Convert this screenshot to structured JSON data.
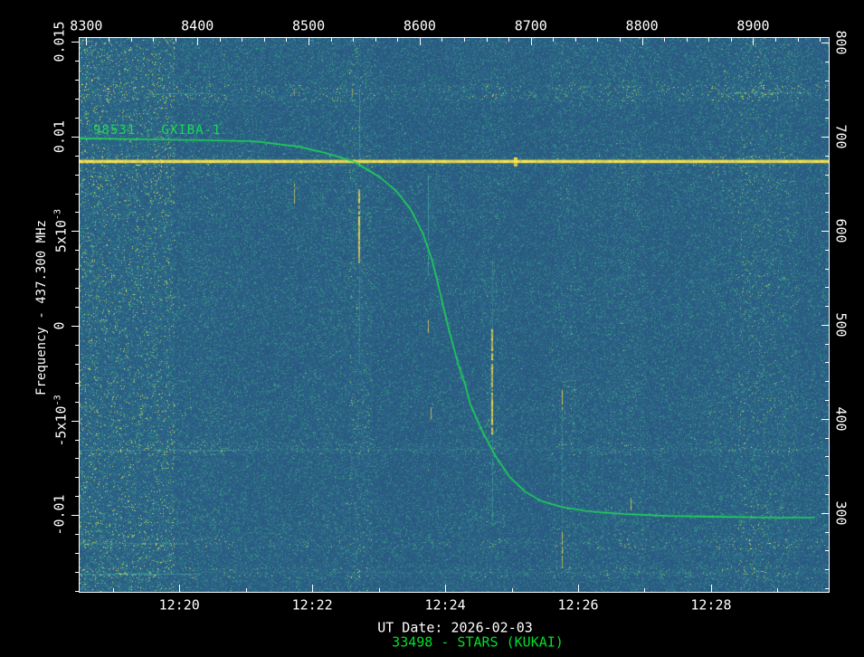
{
  "colors": {
    "background": "#000000",
    "axis_text": "#ffffff",
    "overlay_green": "#15dc52",
    "signal_yellow": "#ffe84d",
    "noise_teal": "#50d7af"
  },
  "footer": {
    "ut_date": "UT Date: 2026-02-03",
    "satellite": "33498 - STARS (KUKAI)"
  },
  "chart_data": {
    "type": "heatmap",
    "subtype": "radio-waterfall-spectrogram",
    "description": "Ground-station waterfall spectrogram (UT time vs frequency offset, power as color) with constant carrier line and predicted satellite Doppler S-curve",
    "grid": "off",
    "time_axis": {
      "side": "bottom",
      "tick_minutes": [
        20,
        22,
        24,
        26,
        28
      ],
      "tick_labels": [
        "12:20",
        "12:22",
        "12:24",
        "12:26",
        "12:28"
      ],
      "minor_step_minutes": 1,
      "range_minutes_after_1200": [
        18.5,
        29.77
      ]
    },
    "record_axis": {
      "side": "top",
      "ticks": [
        8300,
        8400,
        8500,
        8600,
        8700,
        8800,
        8900
      ],
      "minor_step": 20,
      "range": [
        8294,
        8968
      ]
    },
    "freq_axis": {
      "side": "left",
      "title": "Frequency - 437.300 MHz",
      "units": "MHz offset",
      "ticks": [
        {
          "value": 0.015,
          "label": "0.015",
          "exp": ""
        },
        {
          "value": 0.01,
          "label": "0.01",
          "exp": ""
        },
        {
          "value": 0.005,
          "label": "5x10",
          "exp": "-3"
        },
        {
          "value": 0,
          "label": "0",
          "exp": ""
        },
        {
          "value": -0.005,
          "label": "-5x10",
          "exp": "-3"
        },
        {
          "value": -0.01,
          "label": "-0.01",
          "exp": ""
        }
      ],
      "minor_step": 0.001,
      "range": [
        -0.01405,
        0.0152
      ]
    },
    "bin_axis": {
      "side": "right",
      "ticks": [
        800,
        700,
        600,
        500,
        400,
        300
      ],
      "minor_step": 20,
      "range": [
        216,
        805
      ]
    },
    "carrier_line": {
      "freq_offset": 0.0087,
      "color": "#ffe84d",
      "note": "horizontal carrier signal across entire pass"
    },
    "doppler_curve": {
      "label": "98531 - GXIBA-1",
      "color": "#1fd755",
      "points_t_f": [
        [
          18.5,
          0.0099
        ],
        [
          20.0,
          0.00982
        ],
        [
          21.12,
          0.00975
        ],
        [
          21.8,
          0.00946
        ],
        [
          22.2,
          0.00913
        ],
        [
          22.64,
          0.00865
        ],
        [
          23.02,
          0.00784
        ],
        [
          23.25,
          0.00717
        ],
        [
          23.47,
          0.00621
        ],
        [
          23.66,
          0.00492
        ],
        [
          23.8,
          0.00349
        ],
        [
          23.88,
          0.00239
        ],
        [
          23.96,
          0.0012
        ],
        [
          24.04,
          0.0
        ],
        [
          24.12,
          -0.00105
        ],
        [
          24.2,
          -0.00206
        ],
        [
          24.3,
          -0.00311
        ],
        [
          24.38,
          -0.00416
        ],
        [
          24.56,
          -0.00559
        ],
        [
          24.75,
          -0.00684
        ],
        [
          24.97,
          -0.00798
        ],
        [
          25.2,
          -0.00875
        ],
        [
          25.43,
          -0.00923
        ],
        [
          25.74,
          -0.00956
        ],
        [
          26.15,
          -0.0098
        ],
        [
          26.69,
          -0.00994
        ],
        [
          27.37,
          -0.01004
        ],
        [
          28.19,
          -0.01009
        ],
        [
          29.01,
          -0.01013
        ],
        [
          29.55,
          -0.01013
        ]
      ]
    },
    "noise_texture": {
      "base_colors": [
        "#29587f",
        "#2f678d",
        "#2f8a8b",
        "#3fb27f",
        "#f4e84a"
      ],
      "vertical_bands": [
        {
          "t": [
            18.5,
            19.92
          ],
          "boost": 0.1
        },
        {
          "t": [
            22.55,
            22.9
          ],
          "boost": 0.05
        },
        {
          "t": [
            24.55,
            24.9
          ],
          "boost": 0.04
        },
        {
          "t": [
            25.6,
            25.95
          ],
          "boost": 0.04
        },
        {
          "t": [
            26.6,
            27.0
          ],
          "boost": 0.03
        },
        {
          "t": [
            28.4,
            29.3
          ],
          "boost": 0.04
        }
      ],
      "horizontal_bands": [
        {
          "f": [
            0.0119,
            0.0128
          ],
          "boost": 0.07
        },
        {
          "f": [
            0.0084,
            0.009
          ],
          "boost": 0.04
        },
        {
          "f": [
            -0.0061,
            -0.0068
          ],
          "boost": 0.05
        },
        {
          "f": [
            -0.0112,
            -0.0118
          ],
          "boost": 0.05
        },
        {
          "f": [
            -0.0127,
            -0.0133
          ],
          "boost": 0.06
        }
      ],
      "bright_lines": [
        {
          "f": -0.00655,
          "t": [
            18.5,
            21.2
          ],
          "a": 0.28
        },
        {
          "f": -0.01147,
          "t": [
            18.5,
            20.1
          ],
          "a": 0.25
        },
        {
          "f": -0.0131,
          "t": [
            18.5,
            20.3
          ],
          "a": 0.4
        },
        {
          "f": 0.0123,
          "t": [
            19.5,
            20.5
          ],
          "a": 0.3
        },
        {
          "f": 0.01235,
          "t": [
            28.3,
            29.4
          ],
          "a": 0.3
        },
        {
          "f": -0.0065,
          "t": [
            21.3,
            29.77
          ],
          "a": 0.1
        },
        {
          "f": -0.013,
          "t": [
            20.3,
            29.77
          ],
          "a": 0.08
        }
      ],
      "streaks": [
        {
          "t": 22.71,
          "f": [
            0.0125,
            0.009
          ],
          "c": "teal",
          "a": 0.55,
          "w": 1
        },
        {
          "t": 22.71,
          "f": [
            0.0072,
            0.0034
          ],
          "c": "yellow",
          "a": 0.95,
          "w": 2
        },
        {
          "t": 22.71,
          "f": [
            0.0032,
            -0.002
          ],
          "c": "teal",
          "a": 0.35,
          "w": 1
        },
        {
          "t": 21.73,
          "f": [
            0.0075,
            0.0065
          ],
          "c": "yellow",
          "a": 0.8,
          "w": 1
        },
        {
          "t": 21.73,
          "f": [
            0.0125,
            0.0122
          ],
          "c": "yellow",
          "a": 0.6,
          "w": 1
        },
        {
          "t": 23.74,
          "f": [
            0.008,
            0.0027
          ],
          "c": "teal",
          "a": 0.5,
          "w": 1
        },
        {
          "t": 23.74,
          "f": [
            0.0003,
            -0.0003
          ],
          "c": "yellow",
          "a": 0.9,
          "w": 1
        },
        {
          "t": 23.78,
          "f": [
            -0.0043,
            -0.0049
          ],
          "c": "yellow",
          "a": 0.7,
          "w": 1
        },
        {
          "t": 24.71,
          "f": [
            -0.0002,
            -0.0057
          ],
          "c": "yellow",
          "a": 0.95,
          "w": 2
        },
        {
          "t": 24.71,
          "f": [
            -0.0057,
            -0.0105
          ],
          "c": "teal",
          "a": 0.4,
          "w": 1
        },
        {
          "t": 24.71,
          "f": [
            0.0035,
            -0.0002
          ],
          "c": "teal",
          "a": 0.3,
          "w": 1
        },
        {
          "t": 25.75,
          "f": [
            -0.0034,
            -0.0044
          ],
          "c": "yellow",
          "a": 0.9,
          "w": 1
        },
        {
          "t": 25.75,
          "f": [
            -0.0109,
            -0.0127
          ],
          "c": "yellow",
          "a": 0.85,
          "w": 1
        },
        {
          "t": 25.75,
          "f": [
            -0.0044,
            -0.0108
          ],
          "c": "teal",
          "a": 0.35,
          "w": 1
        },
        {
          "t": 26.79,
          "f": [
            -0.0091,
            -0.0097
          ],
          "c": "yellow",
          "a": 0.9,
          "w": 1
        },
        {
          "t": 28.65,
          "f": [
            0.0121,
            0.0126
          ],
          "c": "teal",
          "a": 0.8,
          "w": 1
        },
        {
          "t": 29.0,
          "f": [
            0.0119,
            0.0127
          ],
          "c": "teal",
          "a": 0.7,
          "w": 1
        },
        {
          "t": 25.06,
          "f": [
            0.0089,
            0.0085
          ],
          "c": "yellow",
          "a": 1.0,
          "w": 4
        }
      ]
    }
  }
}
